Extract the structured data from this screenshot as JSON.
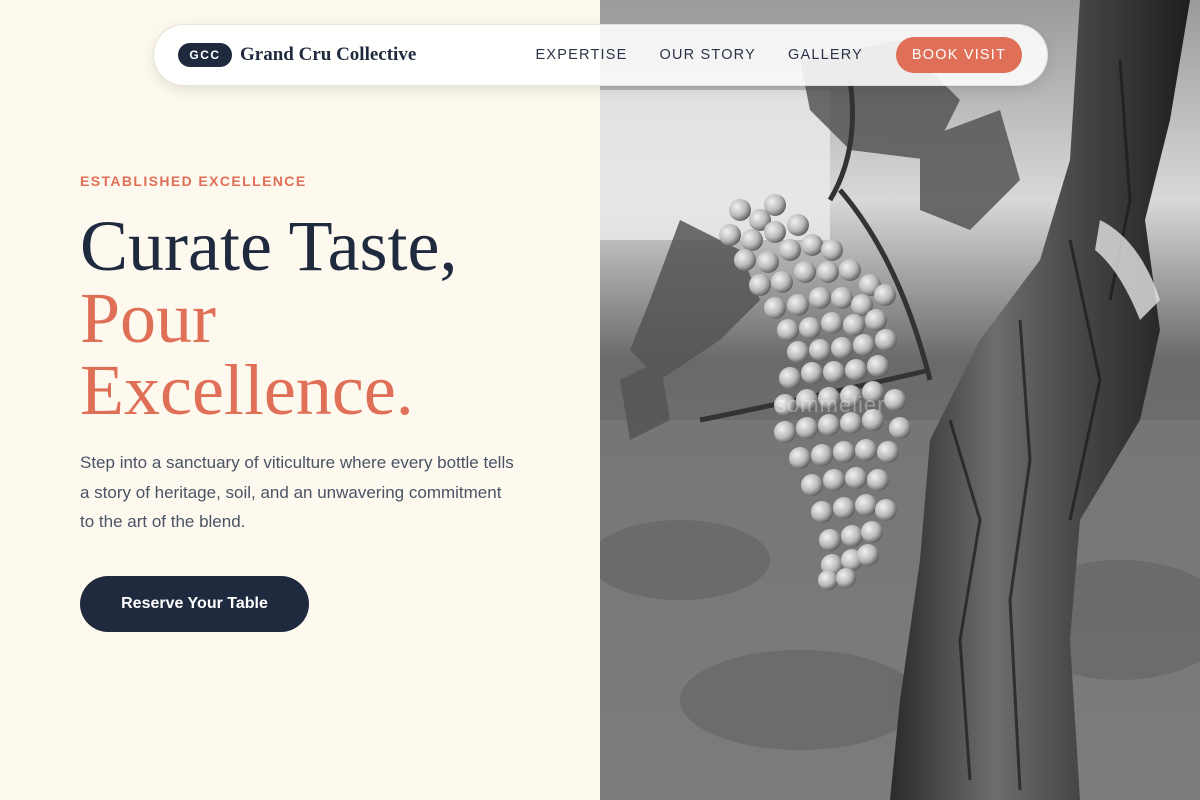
{
  "nav": {
    "brand_badge": "GCC",
    "brand_name": "Grand Cru Collective",
    "links": [
      "EXPERTISE",
      "OUR STORY",
      "GALLERY"
    ],
    "book_label": "BOOK VISIT"
  },
  "hero": {
    "eyebrow": "ESTABLISHED EXCELLENCE",
    "headline_line1": "Curate Taste,",
    "headline_line2": "Pour",
    "headline_line3": "Excellence.",
    "body": "Step into a sanctuary of viticulture where every bottle tells a story of heritage, soil, and an unwavering commitment to the art of the blend.",
    "cta_label": "Reserve Your Table"
  },
  "image": {
    "description_icon": "vineyard-grapes-photo",
    "watermark": "sommelier"
  },
  "colors": {
    "background": "#fdf9ee",
    "navy": "#1f2a3f",
    "accent": "#e06f58",
    "body_text": "#4a5366"
  }
}
